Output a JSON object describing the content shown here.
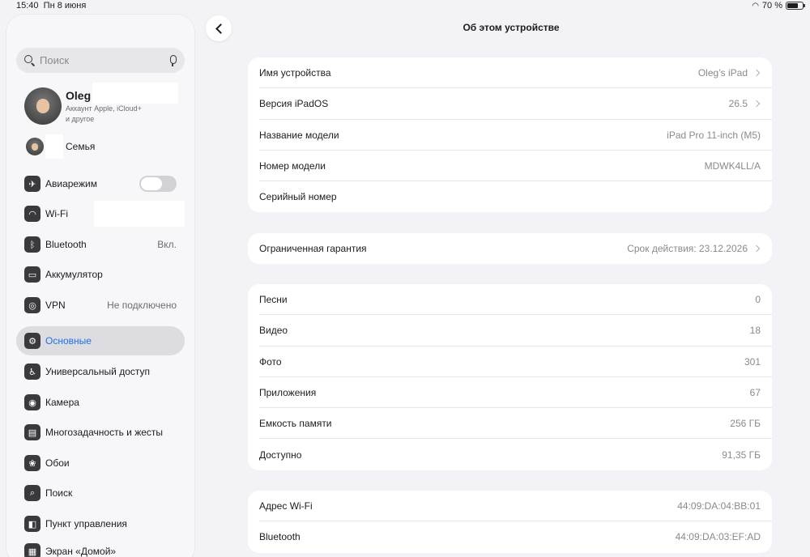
{
  "status_bar": {
    "time": "15:40",
    "date": "Пн 8 июня",
    "battery": "70 %",
    "battery_level": 0.7
  },
  "search": {
    "placeholder": "Поиск"
  },
  "profile": {
    "name": "Oleg",
    "subtitle_1": "Аккаунт Apple, iCloud+",
    "subtitle_2": "и другое"
  },
  "family": {
    "label": "Семья"
  },
  "sidebar": {
    "items": [
      {
        "label": "Авиарежим",
        "icon": "airplane-icon"
      },
      {
        "label": "Wi-Fi",
        "icon": "wifi-icon"
      },
      {
        "label": "Bluetooth",
        "value": "Вкл.",
        "icon": "bluetooth-icon"
      },
      {
        "label": "Аккумулятор",
        "icon": "battery-icon"
      },
      {
        "label": "VPN",
        "value": "Не подключено",
        "icon": "globe-icon"
      },
      {
        "label": "Основные",
        "icon": "gear-icon"
      },
      {
        "label": "Универсальный доступ",
        "icon": "accessibility-icon"
      },
      {
        "label": "Камера",
        "icon": "camera-icon"
      },
      {
        "label": "Многозадачность и жесты",
        "icon": "multitasking-icon"
      },
      {
        "label": "Обои",
        "icon": "wallpaper-icon"
      },
      {
        "label": "Поиск",
        "icon": "search-icon"
      },
      {
        "label": "Пункт управления",
        "icon": "control-center-icon"
      },
      {
        "label": "Экран «Домой»",
        "icon": "home-screen-icon"
      }
    ]
  },
  "main": {
    "title": "Об этом устройстве",
    "group1": [
      {
        "label": "Имя устройства",
        "value": "Oleg’s iPad"
      },
      {
        "label": "Версия iPadOS",
        "value": "26.5"
      },
      {
        "label": "Название модели",
        "value": "iPad Pro 11-inch (M5)"
      },
      {
        "label": "Номер модели",
        "value": "MDWK4LL/A"
      },
      {
        "label": "Серийный номер",
        "value": ""
      }
    ],
    "group2": [
      {
        "label": "Ограниченная гарантия",
        "value": "Срок действия: 23.12.2026"
      }
    ],
    "group3": [
      {
        "label": "Песни",
        "value": "0"
      },
      {
        "label": "Видео",
        "value": "18"
      },
      {
        "label": "Фото",
        "value": "301"
      },
      {
        "label": "Приложения",
        "value": "67"
      },
      {
        "label": "Емкость памяти",
        "value": "256 ГБ"
      },
      {
        "label": "Доступно",
        "value": "91,35 ГБ"
      }
    ],
    "group4": [
      {
        "label": "Адрес Wi-Fi",
        "value": "44:09:DA:04:BB:01"
      },
      {
        "label": "Bluetooth",
        "value": "44:09:DA:03:EF:AD"
      }
    ]
  }
}
